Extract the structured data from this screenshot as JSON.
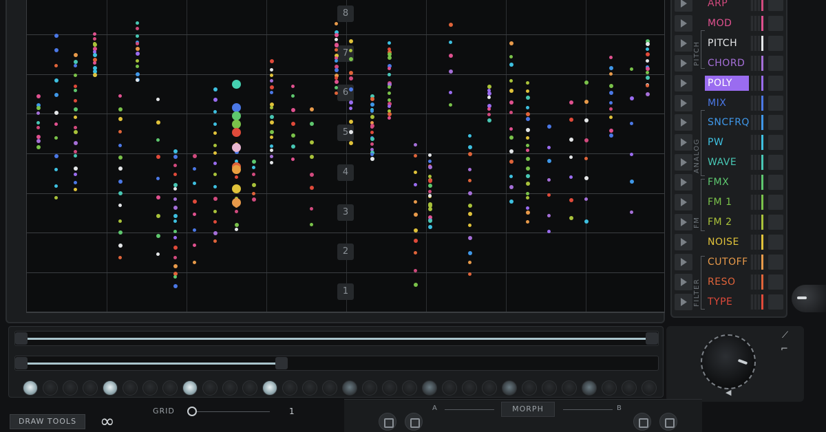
{
  "grid": {
    "step_labels": [
      "8",
      "7",
      "6",
      "5",
      "4",
      "3",
      "2",
      "1"
    ]
  },
  "parameters": [
    {
      "label": "ARP",
      "color": "#d24a7e",
      "active": false
    },
    {
      "label": "MOD",
      "color": "#e0518f",
      "active": false
    },
    {
      "label": "PITCH",
      "color": "#e4e6e8",
      "active": false
    },
    {
      "label": "CHORD",
      "color": "#a56fd8",
      "active": false
    },
    {
      "label": "POLY",
      "color": "#9a6cf0",
      "active": true
    },
    {
      "label": "MIX",
      "color": "#4b78e6",
      "active": false
    },
    {
      "label": "SNCFRQ",
      "color": "#3f97e8",
      "active": false
    },
    {
      "label": "PW",
      "color": "#3ec0e0",
      "active": false
    },
    {
      "label": "WAVE",
      "color": "#48c7b4",
      "active": false
    },
    {
      "label": "FMX",
      "color": "#5ec76e",
      "active": false
    },
    {
      "label": "FM 1",
      "color": "#7ac24a",
      "active": false
    },
    {
      "label": "FM 2",
      "color": "#a9c23a",
      "active": false
    },
    {
      "label": "NOISE",
      "color": "#e0c23a",
      "active": false
    },
    {
      "label": "CUTOFF",
      "color": "#e89a4a",
      "active": false
    },
    {
      "label": "RESO",
      "color": "#e0643a",
      "active": false
    },
    {
      "label": "TYPE",
      "color": "#e04a3a",
      "active": false
    }
  ],
  "groups": [
    "PITCH",
    "ANALOG",
    "FM",
    "FILTER"
  ],
  "bottom": {
    "draw_tools_label": "DRAW TOOLS",
    "infinity_symbol": "∞",
    "grid_label": "GRID",
    "grid_value": "1",
    "morph_label": "MORPH",
    "a_label": "A",
    "b_label": "B"
  },
  "sequencer": {
    "step_count": 32,
    "on_steps": [
      0,
      4,
      8,
      12
    ],
    "dim_steps": [
      16,
      20,
      24,
      28
    ]
  }
}
